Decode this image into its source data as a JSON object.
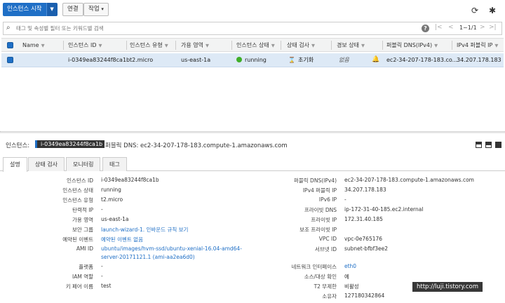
{
  "toolbar": {
    "launch_label": "인스턴스 시작",
    "connect_label": "연결",
    "actions_label": "작업"
  },
  "search": {
    "placeholder": "태그 및 속성별 필터 또는 키워드별 검색",
    "pager": "1~1/1"
  },
  "table": {
    "columns": [
      "Name",
      "인스턴스 ID",
      "인스턴스 유형",
      "가용 영역",
      "인스턴스 상태",
      "상태 검사",
      "경보 상태",
      "퍼블릭 DNS(IPv4)",
      "IPv4 퍼블릭 IP"
    ],
    "row": {
      "name": "",
      "instance_id": "i-0349ea83244f8ca1b",
      "type": "t2.micro",
      "az": "us-east-1a",
      "state": "running",
      "status_check": "초기화",
      "alarm": "없음",
      "public_dns": "ec2-34-207-178-183.co...",
      "public_ip": "34.207.178.183"
    }
  },
  "details": {
    "header_label": "인스턴스:",
    "instance_id": "i-0349ea83244f8ca1b",
    "public_dns_header": "퍼블릭 DNS: ec2-34-207-178-183.compute-1.amazonaws.com",
    "tabs": [
      "설명",
      "상태 검사",
      "모니터링",
      "태그"
    ],
    "left": [
      {
        "label": "인스턴스 ID",
        "value": "i-0349ea83244f8ca1b"
      },
      {
        "label": "인스턴스 상태",
        "value": "running"
      },
      {
        "label": "인스턴스 유형",
        "value": "t2.micro"
      },
      {
        "label": "탄력적 IP",
        "value": "-"
      },
      {
        "label": "가용 영역",
        "value": "us-east-1a"
      },
      {
        "label": "보안 그룹",
        "value": "launch-wizard-1. 인바운드 규칙 보기"
      },
      {
        "label": "예약된 이벤트",
        "value": "예약된 이벤트 없음"
      },
      {
        "label": "AMI ID",
        "value": "ubuntu/images/hvm-ssd/ubuntu-xenial-16.04-amd64-",
        "value2": "server-20171121.1 (ami-aa2ea6d0)"
      },
      {
        "label": "플랫폼",
        "value": "-"
      },
      {
        "label": "IAM 역할",
        "value": "-"
      },
      {
        "label": "키 페어 이름",
        "value": "test"
      }
    ],
    "right": [
      {
        "label": "퍼블릭 DNS(IPv4)",
        "value": "ec2-34-207-178-183.compute-1.amazonaws.com"
      },
      {
        "label": "IPv4 퍼블릭 IP",
        "value": "34.207.178.183"
      },
      {
        "label": "IPv6 IP",
        "value": "-"
      },
      {
        "label": "프라이빗 DNS",
        "value": "ip-172-31-40-185.ec2.internal"
      },
      {
        "label": "프라이빗 IP",
        "value": "172.31.40.185"
      },
      {
        "label": "보조 프라이빗 IP",
        "value": ""
      },
      {
        "label": "VPC ID",
        "value": "vpc-0e765176"
      },
      {
        "label": "서브넷 ID",
        "value": "subnet-bfbf3ee2"
      },
      {
        "label": "네트워크 인터페이스",
        "value": "eth0"
      },
      {
        "label": "소스/대상 확인",
        "value": "예"
      },
      {
        "label": "T2 무제한",
        "value": "비활성"
      },
      {
        "label": "소유자",
        "value": "127180342864"
      }
    ]
  },
  "watermark": "http://luji.tistory.com"
}
